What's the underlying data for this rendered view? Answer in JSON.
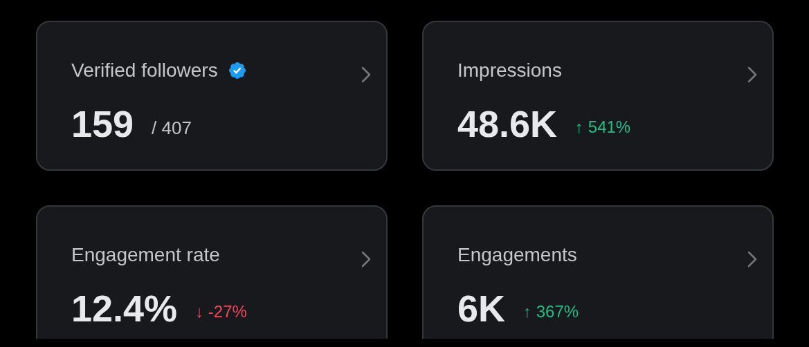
{
  "cards": [
    {
      "title": "Verified followers",
      "verified": true,
      "value": "159",
      "total": "/ 407"
    },
    {
      "title": "Impressions",
      "verified": false,
      "value": "48.6K",
      "trend": {
        "positive": true,
        "arrow": "↑",
        "change": "541%"
      }
    },
    {
      "title": "Engagement rate",
      "verified": false,
      "value": "12.4%",
      "trend": {
        "positive": false,
        "arrow": "↓",
        "change": "-27%"
      }
    },
    {
      "title": "Engagements",
      "verified": false,
      "value": "6K",
      "trend": {
        "positive": true,
        "arrow": "↑",
        "change": "367%"
      }
    }
  ]
}
